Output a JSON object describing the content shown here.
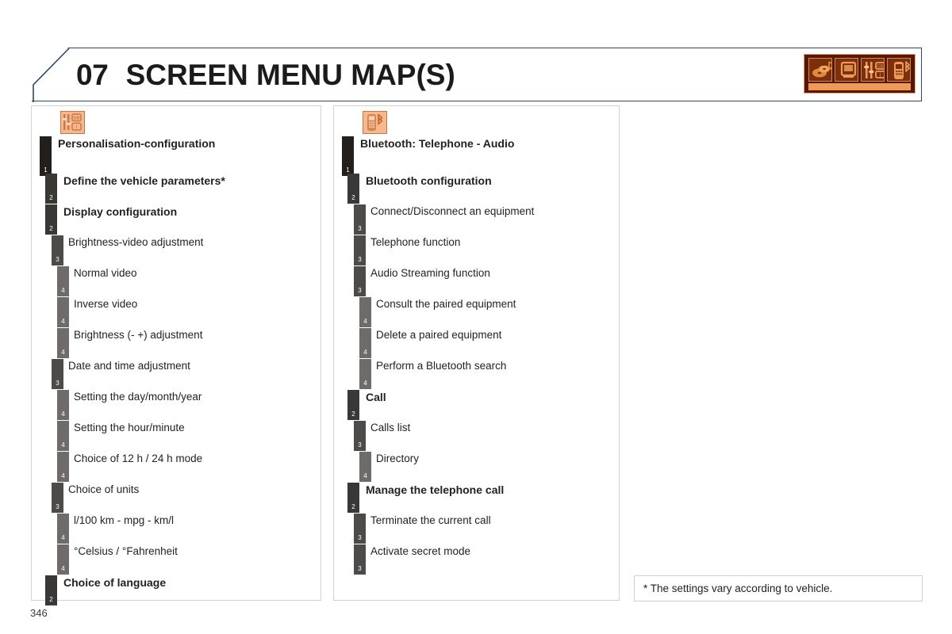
{
  "header": {
    "chapter_number": "07",
    "title": "SCREEN MENU MAP(S)",
    "border_color": "#2d4663",
    "chapter_icon": {
      "name": "chapter-icon-strip",
      "background": "#54180a",
      "bar_color": "#ec9a56",
      "tiles": [
        "audio-cd-music-icon",
        "display-screen-icon",
        "personalisation-sliders-icon",
        "telephone-bluetooth-icon"
      ]
    }
  },
  "columns": [
    {
      "id": "personalisation",
      "icon": "personalisation-language-icon",
      "rows": [
        {
          "level": 1,
          "label": "Personalisation-configuration"
        },
        {
          "level": 2,
          "label": "Define the vehicle parameters*"
        },
        {
          "level": 2,
          "label": "Display configuration"
        },
        {
          "level": 3,
          "label": "Brightness-video adjustment"
        },
        {
          "level": 4,
          "label": "Normal video"
        },
        {
          "level": 4,
          "label": "Inverse video"
        },
        {
          "level": 4,
          "label": "Brightness (- +) adjustment"
        },
        {
          "level": 3,
          "label": "Date and time adjustment"
        },
        {
          "level": 4,
          "label": "Setting the day/month/year"
        },
        {
          "level": 4,
          "label": "Setting the hour/minute"
        },
        {
          "level": 4,
          "label": "Choice of 12 h / 24 h mode"
        },
        {
          "level": 3,
          "label": "Choice of units"
        },
        {
          "level": 4,
          "label": "l/100 km - mpg - km/l"
        },
        {
          "level": 4,
          "label": "°Celsius / °Fahrenheit"
        },
        {
          "level": 2,
          "label": "Choice of language"
        }
      ]
    },
    {
      "id": "bluetooth",
      "icon": "telephone-bluetooth-icon",
      "rows": [
        {
          "level": 1,
          "label": "Bluetooth: Telephone - Audio"
        },
        {
          "level": 2,
          "label": "Bluetooth configuration"
        },
        {
          "level": 3,
          "label": "Connect/Disconnect an equipment"
        },
        {
          "level": 3,
          "label": "Telephone function"
        },
        {
          "level": 3,
          "label": "Audio Streaming function"
        },
        {
          "level": 4,
          "label": "Consult the paired equipment"
        },
        {
          "level": 4,
          "label": "Delete a paired equipment"
        },
        {
          "level": 4,
          "label": "Perform a Bluetooth search"
        },
        {
          "level": 2,
          "label": "Call"
        },
        {
          "level": 3,
          "label": "Calls list"
        },
        {
          "level": 4,
          "label": "Directory"
        },
        {
          "level": 2,
          "label": "Manage the telephone call"
        },
        {
          "level": 3,
          "label": "Terminate the current call"
        },
        {
          "level": 3,
          "label": "Activate secret mode"
        }
      ]
    }
  ],
  "footnote": {
    "text": "* The settings vary according to vehicle."
  },
  "page_number": "346",
  "level_colors": {
    "1": "#231f1d",
    "2": "#3a3836",
    "3": "#4d4b49",
    "4": "#6e6c6b"
  }
}
